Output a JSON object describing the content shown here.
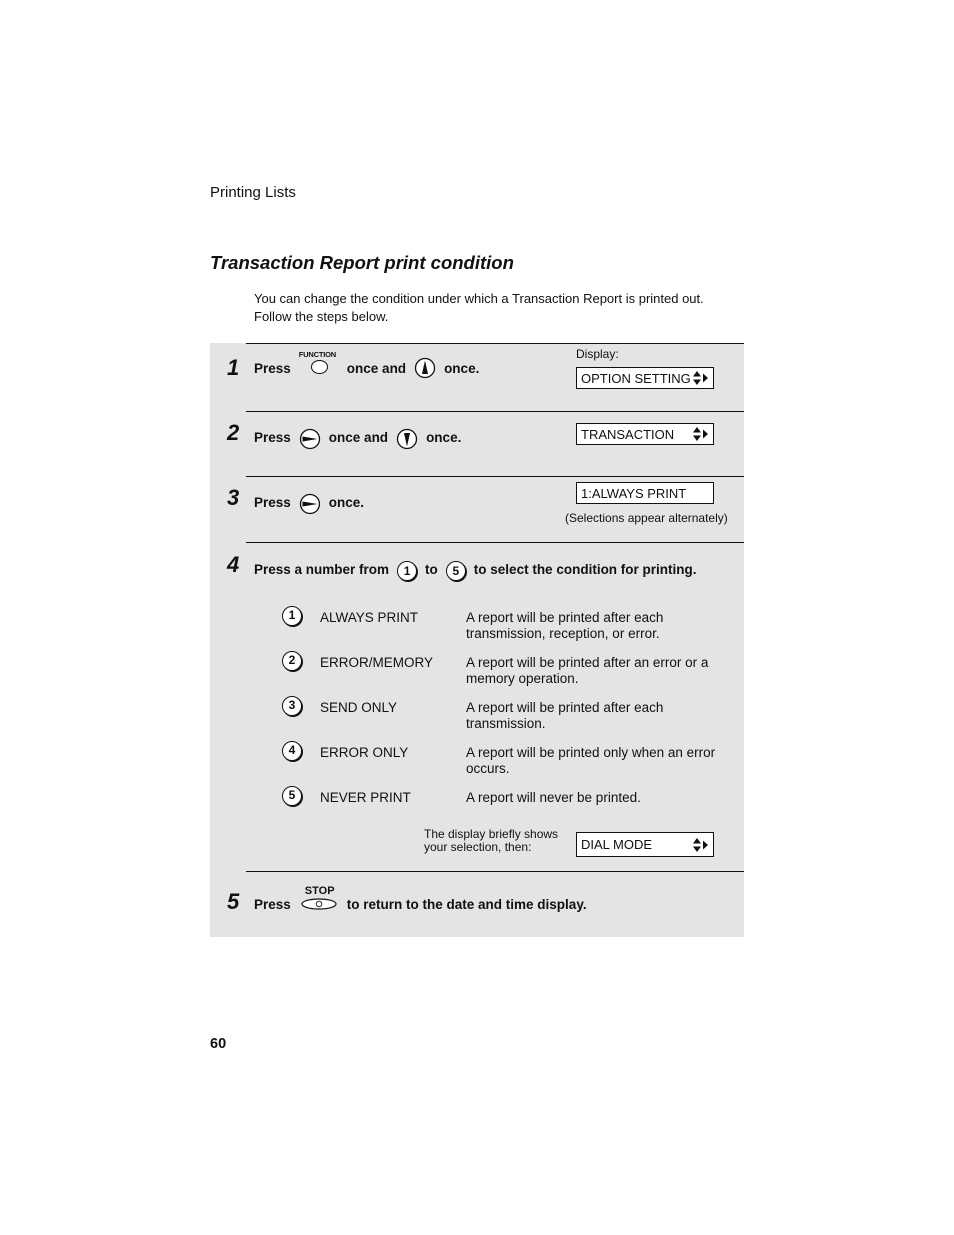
{
  "page": {
    "section_header": "Printing Lists",
    "title": "Transaction Report print condition",
    "intro_line1": "You can change the condition under which a Transaction Report is printed out.",
    "intro_line2": "Follow the steps below.",
    "page_number": "60"
  },
  "display_label": "Display:",
  "steps": [
    {
      "number": "1",
      "press": "Press",
      "key1_label": "FUNCTION",
      "key1_icon": "function-key-icon",
      "mid": "once and",
      "key2_icon": "up-arrow-key-icon",
      "end": "once.",
      "display": "OPTION SETTING"
    },
    {
      "number": "2",
      "press": "Press",
      "key1_icon": "right-arrow-key-icon",
      "mid": "once and",
      "key2_icon": "down-arrow-key-icon",
      "end": "once.",
      "display": "TRANSACTION"
    },
    {
      "number": "3",
      "press": "Press",
      "key1_icon": "right-arrow-key-icon",
      "end": "once.",
      "display": "1:ALWAYS PRINT",
      "note": "(Selections appear alternately)"
    },
    {
      "number": "4",
      "text_a": "Press a number from",
      "key_from": "1",
      "text_b": "to",
      "key_to": "5",
      "text_c": "to select the condition for printing.",
      "options": [
        {
          "key": "1",
          "name": "ALWAYS PRINT",
          "desc1": "A report will be printed after each",
          "desc2": "transmission, reception, or error."
        },
        {
          "key": "2",
          "name": "ERROR/MEMORY",
          "desc1": "A report will be printed after an error or a",
          "desc2": "memory operation."
        },
        {
          "key": "3",
          "name": "SEND ONLY",
          "desc1": "A report will be printed after each",
          "desc2": "transmission."
        },
        {
          "key": "4",
          "name": "ERROR ONLY",
          "desc1": "A report will be printed only when an error",
          "desc2": "occurs."
        },
        {
          "key": "5",
          "name": "NEVER PRINT",
          "desc1": "A report will never be printed.",
          "desc2": ""
        }
      ],
      "brief_line1": "The display briefly shows",
      "brief_line2": "your selection, then:",
      "display": "DIAL MODE"
    },
    {
      "number": "5",
      "press": "Press",
      "key_label": "STOP",
      "key_icon": "stop-key-icon",
      "end": "to return to the date and time display."
    }
  ]
}
